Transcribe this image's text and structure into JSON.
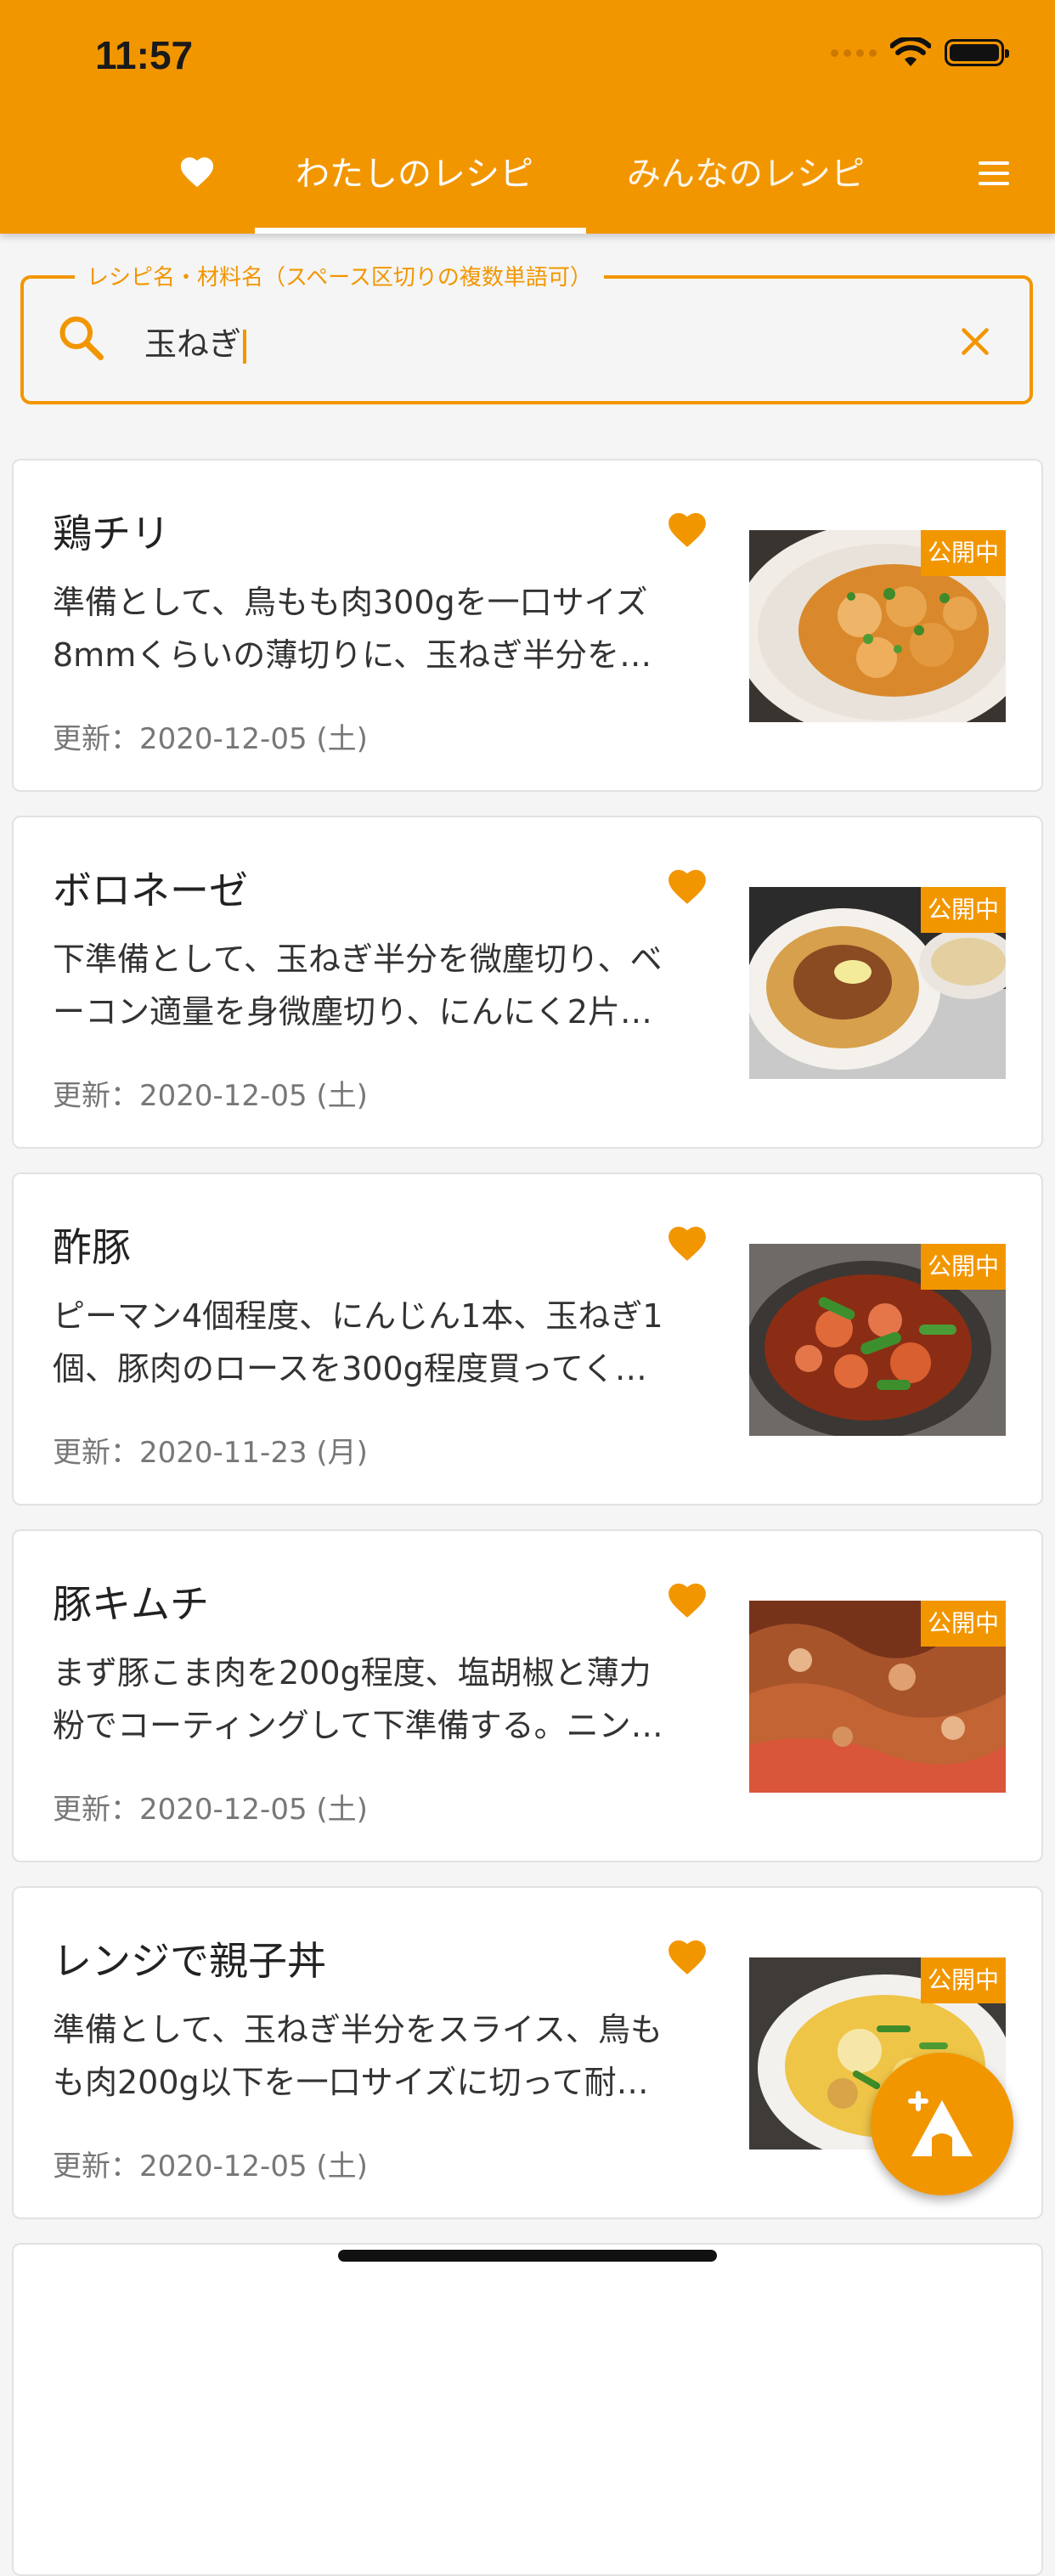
{
  "status_bar": {
    "time": "11:57"
  },
  "header": {
    "tabs": [
      {
        "label": "わたしのレシピ",
        "active": true
      },
      {
        "label": "みんなのレシピ",
        "active": false
      }
    ],
    "favorites_icon": "heart-icon",
    "menu_icon": "hamburger-menu-icon"
  },
  "search": {
    "label": "レシピ名・材料名（スペース区切りの複数単語可）",
    "value": "玉ねぎ"
  },
  "recipes": [
    {
      "title": "鶏チリ",
      "desc_line1": "準備として、鳥もも肉300gを一口サイズ",
      "desc_line2": "8mmくらいの薄切りに、玉ねぎ半分を…",
      "date": "更新：2020-12-05 (土)",
      "badge": "公開中"
    },
    {
      "title": "ボロネーゼ",
      "desc_line1": "下準備として、玉ねぎ半分を微塵切り、ベ",
      "desc_line2": "ーコン適量を身微塵切り、にんにく2片…",
      "date": "更新：2020-12-05 (土)",
      "badge": "公開中"
    },
    {
      "title": "酢豚",
      "desc_line1": "ピーマン4個程度、にんじん1本、玉ねぎ1",
      "desc_line2": "個、豚肉のロースを300g程度買ってく…",
      "date": "更新：2020-11-23 (月)",
      "badge": "公開中"
    },
    {
      "title": "豚キムチ",
      "desc_line1": "まず豚こま肉を200g程度、塩胡椒と薄力",
      "desc_line2": "粉でコーティングして下準備する。ニン…",
      "date": "更新：2020-12-05 (土)",
      "badge": "公開中"
    },
    {
      "title": "レンジで親子丼",
      "desc_line1": "準備として、玉ねぎ半分をスライス、鳥も",
      "desc_line2": "も肉200g以下を一口サイズに切って耐…",
      "date": "更新：2020-12-05 (土)",
      "badge": "公開中"
    }
  ],
  "colors": {
    "primary": "#f29600",
    "background": "#f5f5f5"
  }
}
